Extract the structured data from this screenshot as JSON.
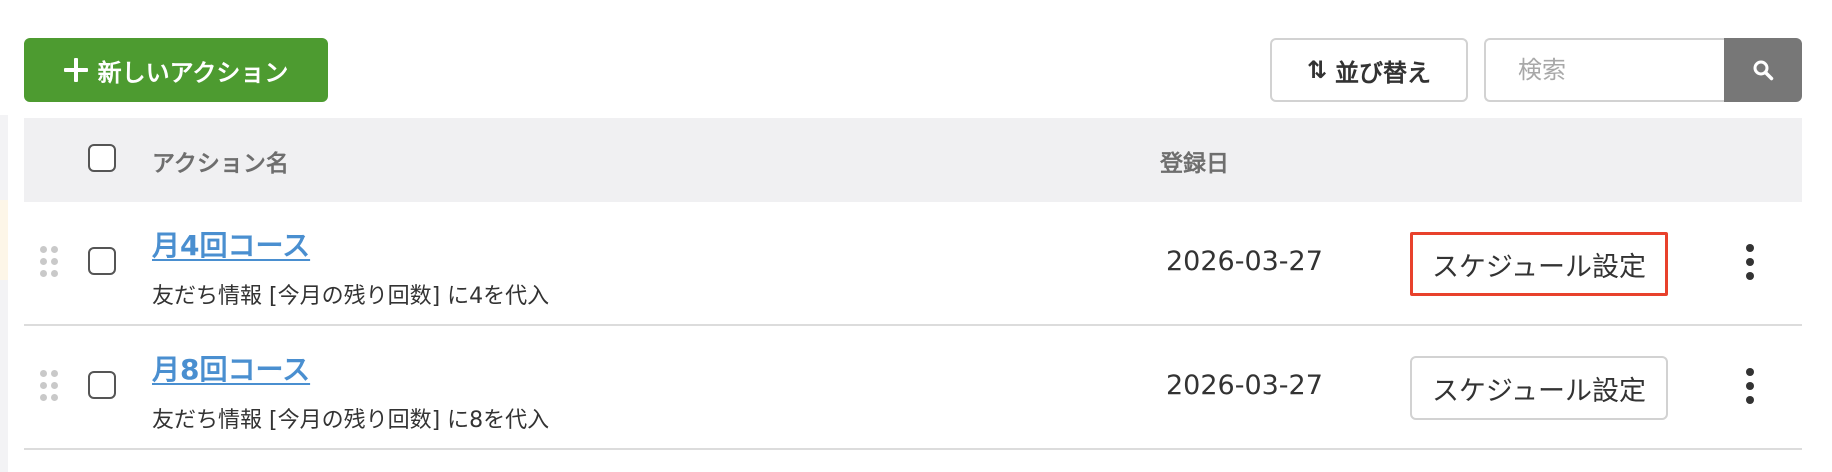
{
  "toolbar": {
    "new_action_label": "新しいアクション",
    "sort_label": "並び替え",
    "search_placeholder": "検索"
  },
  "table": {
    "columns": {
      "name": "アクション名",
      "date": "登録日"
    },
    "rows": [
      {
        "name": "月4回コース",
        "description": "友だち情報 [今月の残り回数] に4を代入",
        "date": "2026-03-27",
        "schedule_label": "スケジュール設定",
        "highlighted": true
      },
      {
        "name": "月8回コース",
        "description": "友だち情報 [今月の残り回数] に8を代入",
        "date": "2026-03-27",
        "schedule_label": "スケジュール設定",
        "highlighted": false
      }
    ]
  },
  "icons": {
    "add": "plus-icon",
    "sort": "sort-arrows-icon",
    "search": "search-icon",
    "drag": "drag-handle-icon",
    "more": "more-vertical-icon"
  },
  "colors": {
    "primary_green": "#4d9b30",
    "link_blue": "#4a8fd0",
    "highlight_red": "#e8412c",
    "search_button_gray": "#777777",
    "header_bg": "#f0f0f2"
  }
}
